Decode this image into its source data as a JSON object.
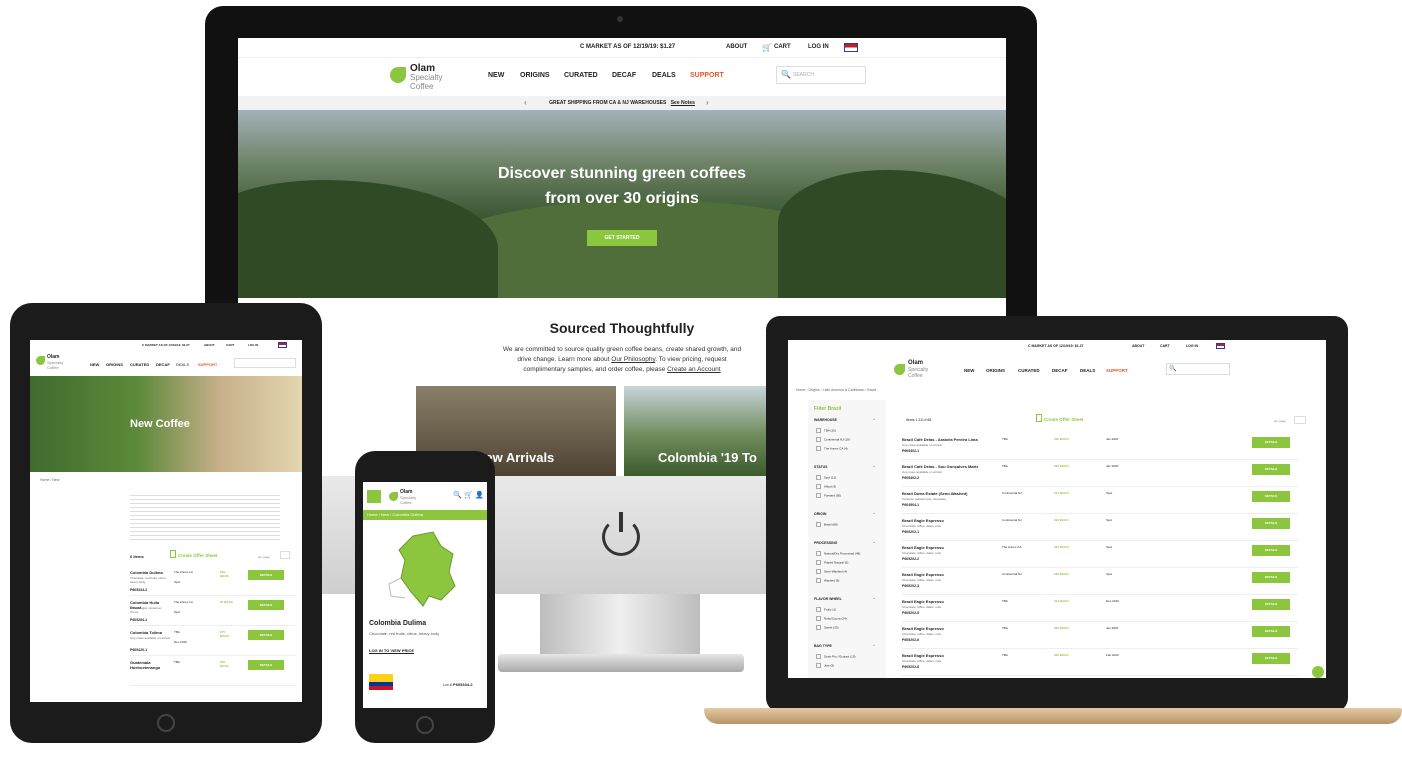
{
  "topbar": {
    "market": "C MARKET AS OF 12/19/19: $1.27",
    "about": "ABOUT",
    "cart": "CART",
    "login": "LOG IN"
  },
  "brand": {
    "line1": "Olam",
    "line2": "Specialty",
    "line3": "Coffee"
  },
  "nav": {
    "new": "NEW",
    "origins": "ORIGINS",
    "curated": "CURATED",
    "decaf": "DECAF",
    "deals": "DEALS",
    "support": "SUPPORT"
  },
  "search": {
    "placeholder": "SEARCH"
  },
  "shipping_banner": {
    "text": "GREAT SHIPPING FROM CA & NJ WAREHOUSES",
    "link": "See Notes"
  },
  "hero": {
    "line1": "Discover stunning green coffees",
    "line2": "from over 30 origins",
    "cta": "GET STARTED"
  },
  "sourced": {
    "heading": "Sourced Thoughtfully",
    "body1": "We are committed to source quality green coffee beans, create shared growth, and",
    "body2": "drive change. Learn more about",
    "link1": "Our Philosophy",
    "body3": ". To view pricing, request",
    "body4": "complimentary samples, and order coffee, please",
    "link2": "Create an Account",
    "cards": [
      "New Arrivals",
      "Colombia '19 To"
    ]
  },
  "tablet": {
    "page_title": "New Coffee",
    "breadcrumb": "Home / New",
    "items_count": "6 Items",
    "offer_sheet": "Create Offer Sheet",
    "per_page": "per page",
    "details": "DETAILS",
    "rows": [
      {
        "name": "Colombia Dulima",
        "notes": "Chocolate, red fruits, citrus, heavy body",
        "lot": "P605334-2",
        "warehouse": "The Annex LA",
        "qty": "166 BAGS",
        "pos": "Spot"
      },
      {
        "name": "Colombia Huila Decaf",
        "notes": "Brown sugar, cinnamon, cherry",
        "lot": "P605284-1",
        "warehouse": "The Annex LA",
        "qty": "37 BAGS",
        "pos": "Spot"
      },
      {
        "name": "Colombia Tolima",
        "notes": "Cup notes available on arrival",
        "lot": "P605420-1",
        "warehouse": "TBA",
        "qty": "275 BAGS",
        "pos": "Dec 2019"
      },
      {
        "name": "Guatemala Huehuetenango",
        "notes": "",
        "lot": "",
        "warehouse": "TBA",
        "qty": "275 BAGS",
        "pos": ""
      }
    ]
  },
  "phone": {
    "breadcrumb": "Home / New / Colombia Dulima",
    "title": "Colombia Dulima",
    "notes": "Chocolate, red fruits, citrus, heavy body",
    "login_price": "LOG IN TO VIEW PRICE",
    "lot_label": "Lot #",
    "lot": "P605334-2"
  },
  "laptop": {
    "breadcrumb": "Home › Origins › Latin America & Caribbean › Brazil",
    "filter_title": "Filter Brazil",
    "items_label": "Items 1-15 of 68",
    "offer_sheet": "Create Offer Sheet",
    "per_page": "per page",
    "details": "DETAILS",
    "filters": [
      {
        "group": "WAREHOUSE",
        "options": [
          "TBA (15)",
          "Continental NJ (18)",
          "The Annex CA (4)"
        ]
      },
      {
        "group": "STATUS",
        "options": [
          "Spot (11)",
          "Afloat (3)",
          "Forward (50)"
        ]
      },
      {
        "group": "ORIGIN",
        "options": [
          "Brazil (68)"
        ]
      },
      {
        "group": "PROCESSING",
        "options": [
          "Natural/Dry Processed (48)",
          "Pulped Natural (5)",
          "Semi-Washed (4)",
          "Washed (6)"
        ]
      },
      {
        "group": "FLAVOR WHEEL",
        "options": [
          "Fruity (1)",
          "Nutty/Cocoa (24)",
          "Sweet (33)"
        ]
      },
      {
        "group": "BAG TYPE",
        "options": [
          "Grain Pro / Ecotact (15)",
          "Jute (5)"
        ]
      }
    ],
    "rows": [
      {
        "name": "Brazil Café Delas - Arabela Pereira Lima",
        "notes": "Cup notes available on arrival",
        "lot": "P605402-1",
        "warehouse": "TBA",
        "qty": "200 BAGS",
        "date": "Jan 2020"
      },
      {
        "name": "Brazil Café Delas - Sou Gonçalves Mariz",
        "notes": "Cup notes available on arrival",
        "lot": "P605402-2",
        "warehouse": "TBA",
        "qty": "200 BAGS",
        "date": "Jan 2020"
      },
      {
        "name": "Brazil Dutra Estate (Semi-Washed)",
        "notes": "Caramel, toasted nuts, chocolate",
        "lot": "P604504-1",
        "warehouse": "Continental NJ",
        "qty": "247 BAGS",
        "date": "Spot"
      },
      {
        "name": "Brazil Eagle Espresso",
        "notes": "Chocolate, toffee, dates, nuts",
        "lot": "P605202-1",
        "warehouse": "Continental NJ",
        "qty": "394 BAGS",
        "date": "Spot"
      },
      {
        "name": "Brazil Eagle Espresso",
        "notes": "Chocolate, toffee, dates, nuts",
        "lot": "P605202-2",
        "warehouse": "The Annex CA",
        "qty": "237 BAGS",
        "date": "Spot"
      },
      {
        "name": "Brazil Eagle Espresso",
        "notes": "Chocolate, toffee, dates, nuts",
        "lot": "P605202-3",
        "warehouse": "Continental NJ",
        "qty": "160 BAGS",
        "date": "Spot"
      },
      {
        "name": "Brazil Eagle Espresso",
        "notes": "Chocolate, toffee, dates, nuts",
        "lot": "P605202-5",
        "warehouse": "TBA",
        "qty": "312 BAGS",
        "date": "Dec 2019"
      },
      {
        "name": "Brazil Eagle Espresso",
        "notes": "Chocolate, toffee, dates, nuts",
        "lot": "P605202-6",
        "warehouse": "TBA",
        "qty": "320 BAGS",
        "date": "Jan 2020"
      },
      {
        "name": "Brazil Eagle Espresso",
        "notes": "Chocolate, toffee, dates, nuts",
        "lot": "P605202-8",
        "warehouse": "TBA",
        "qty": "320 BAGS",
        "date": "Feb 2020"
      }
    ]
  }
}
